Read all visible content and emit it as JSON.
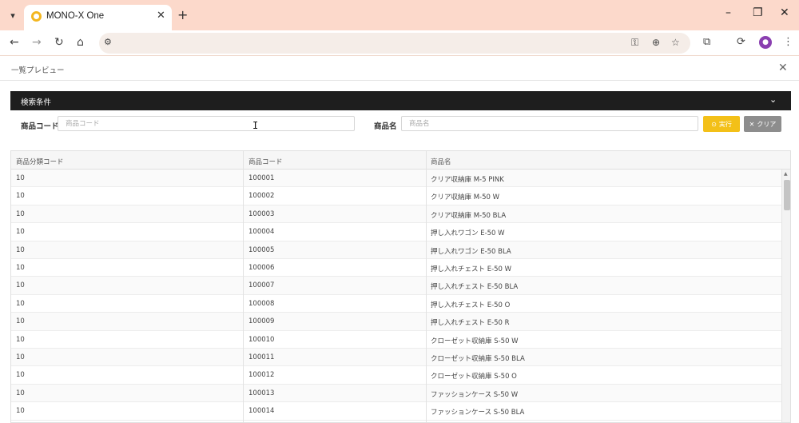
{
  "browser": {
    "tab_title": "MONO-X One",
    "tab_menu_icon": "chevron-down-icon",
    "new_tab": "+",
    "window": {
      "minimize": "–",
      "restore": "❐",
      "close": "✕"
    }
  },
  "app": {
    "title": "一覧プレビュー",
    "close": "✕"
  },
  "search": {
    "panel_title": "検索条件",
    "product_code_label": "商品コード",
    "product_code_placeholder": "商品コード",
    "product_name_label": "商品名",
    "product_name_placeholder": "商品名",
    "execute_label": "実行",
    "clear_label": "クリア"
  },
  "table": {
    "columns": [
      "商品分類コード",
      "商品コード",
      "商品名"
    ],
    "rows": [
      [
        "10",
        "100001",
        "クリア収納庫 M-5 PINK"
      ],
      [
        "10",
        "100002",
        "クリア収納庫 M-50 W"
      ],
      [
        "10",
        "100003",
        "クリア収納庫 M-50 BLA"
      ],
      [
        "10",
        "100004",
        "押し入れワゴン E-50 W"
      ],
      [
        "10",
        "100005",
        "押し入れワゴン E-50 BLA"
      ],
      [
        "10",
        "100006",
        "押し入れチェスト E-50 W"
      ],
      [
        "10",
        "100007",
        "押し入れチェスト E-50 BLA"
      ],
      [
        "10",
        "100008",
        "押し入れチェスト E-50 O"
      ],
      [
        "10",
        "100009",
        "押し入れチェスト E-50 R"
      ],
      [
        "10",
        "100010",
        "クローゼット収納庫 S-50 W"
      ],
      [
        "10",
        "100011",
        "クローゼット収納庫 S-50 BLA"
      ],
      [
        "10",
        "100012",
        "クローゼット収納庫 S-50 O"
      ],
      [
        "10",
        "100013",
        "ファッションケース S-50 W"
      ],
      [
        "10",
        "100014",
        "ファッションケース S-50 BLA"
      ]
    ]
  },
  "colors": {
    "tabbar": "#fcd9cb",
    "search_header": "#1e1e1e",
    "execute_button": "#f3c018",
    "clear_button": "#8d8d8d"
  }
}
